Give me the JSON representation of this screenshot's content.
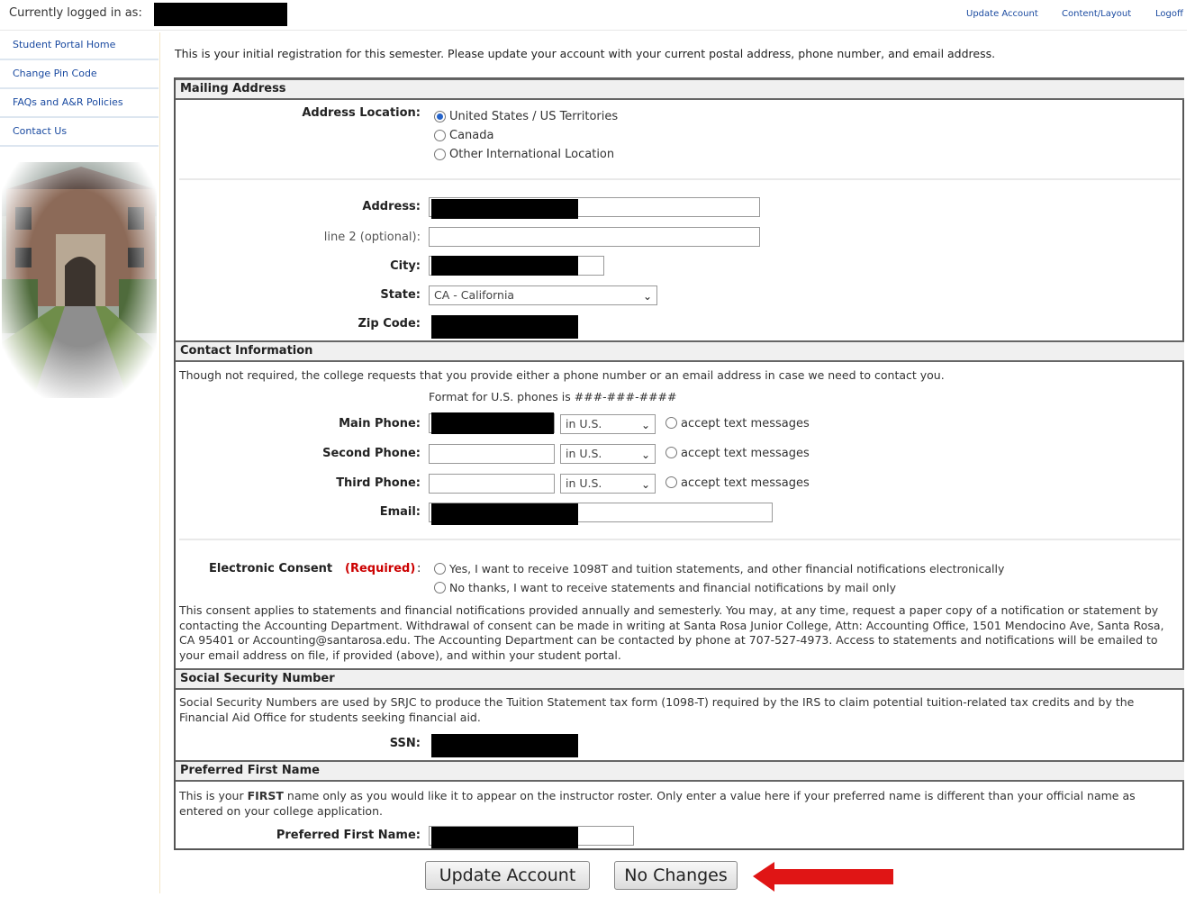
{
  "header": {
    "logged_in_label": "Currently logged in as:",
    "links": [
      "Update Account",
      "Content/Layout",
      "Logoff"
    ]
  },
  "sidebar": {
    "items": [
      {
        "label": "Student Portal Home"
      },
      {
        "label": "Change Pin Code"
      },
      {
        "label": "FAQs and A&R Policies"
      },
      {
        "label": "Contact Us"
      }
    ]
  },
  "intro": "This is your initial registration for this semester. Please update your account with your current postal address, phone number, and email address.",
  "mailing": {
    "title": "Mailing Address",
    "location_label": "Address Location:",
    "options": [
      "United States / US Territories",
      "Canada",
      "Other International Location"
    ],
    "selected": "United States / US Territories",
    "address_label": "Address:",
    "line2_label": "line 2 (optional):",
    "city_label": "City:",
    "state_label": "State:",
    "state_value": "CA - California",
    "zip_label": "Zip Code:"
  },
  "contact": {
    "title": "Contact Information",
    "note": "Though not required, the college requests that you provide either a phone number or an email address in case we need to contact you.",
    "format_note": "Format for U.S. phones is ###-###-####",
    "main_phone_label": "Main Phone:",
    "second_phone_label": "Second Phone:",
    "third_phone_label": "Third Phone:",
    "email_label": "Email:",
    "region_value": "in U.S.",
    "accept_text": "accept text messages",
    "consent_label": "Electronic Consent",
    "required": "(Required)",
    "consent_yes": "Yes, I want to receive 1098T and tuition statements, and other financial notifications electronically",
    "consent_no": "No thanks, I want to receive statements and financial notifications by mail only",
    "consent_text": "This consent applies to statements and financial notifications provided annually and semesterly. You may, at any time, request a paper copy of a notification or statement by contacting the Accounting Department. Withdrawal of consent can be made in writing at Santa Rosa Junior College, Attn: Accounting Office, 1501 Mendocino Ave, Santa Rosa, CA 95401 or Accounting@santarosa.edu. The Accounting Department can be contacted by phone at 707-527-4973. Access to statements and notifications will be emailed to your email address on file, if provided (above), and within your student portal."
  },
  "ssn": {
    "title": "Social Security Number",
    "text": "Social Security Numbers are used by SRJC to produce the Tuition Statement tax form (1098-T) required by the IRS to claim potential tuition-related tax credits and by the Financial Aid Office for students seeking financial aid.",
    "label": "SSN:"
  },
  "preferred": {
    "title": "Preferred First Name",
    "text_pre": "This is your ",
    "text_bold": "FIRST",
    "text_post": " name only as you would like it to appear on the instructor roster. Only enter a value here if your preferred name is different than your official name as entered on your college application.",
    "label": "Preferred First Name:"
  },
  "buttons": {
    "update": "Update Account",
    "no_changes": "No Changes"
  },
  "colors": {
    "link": "#1a4aa0",
    "arrow": "#e01515",
    "required": "#cc0000"
  }
}
